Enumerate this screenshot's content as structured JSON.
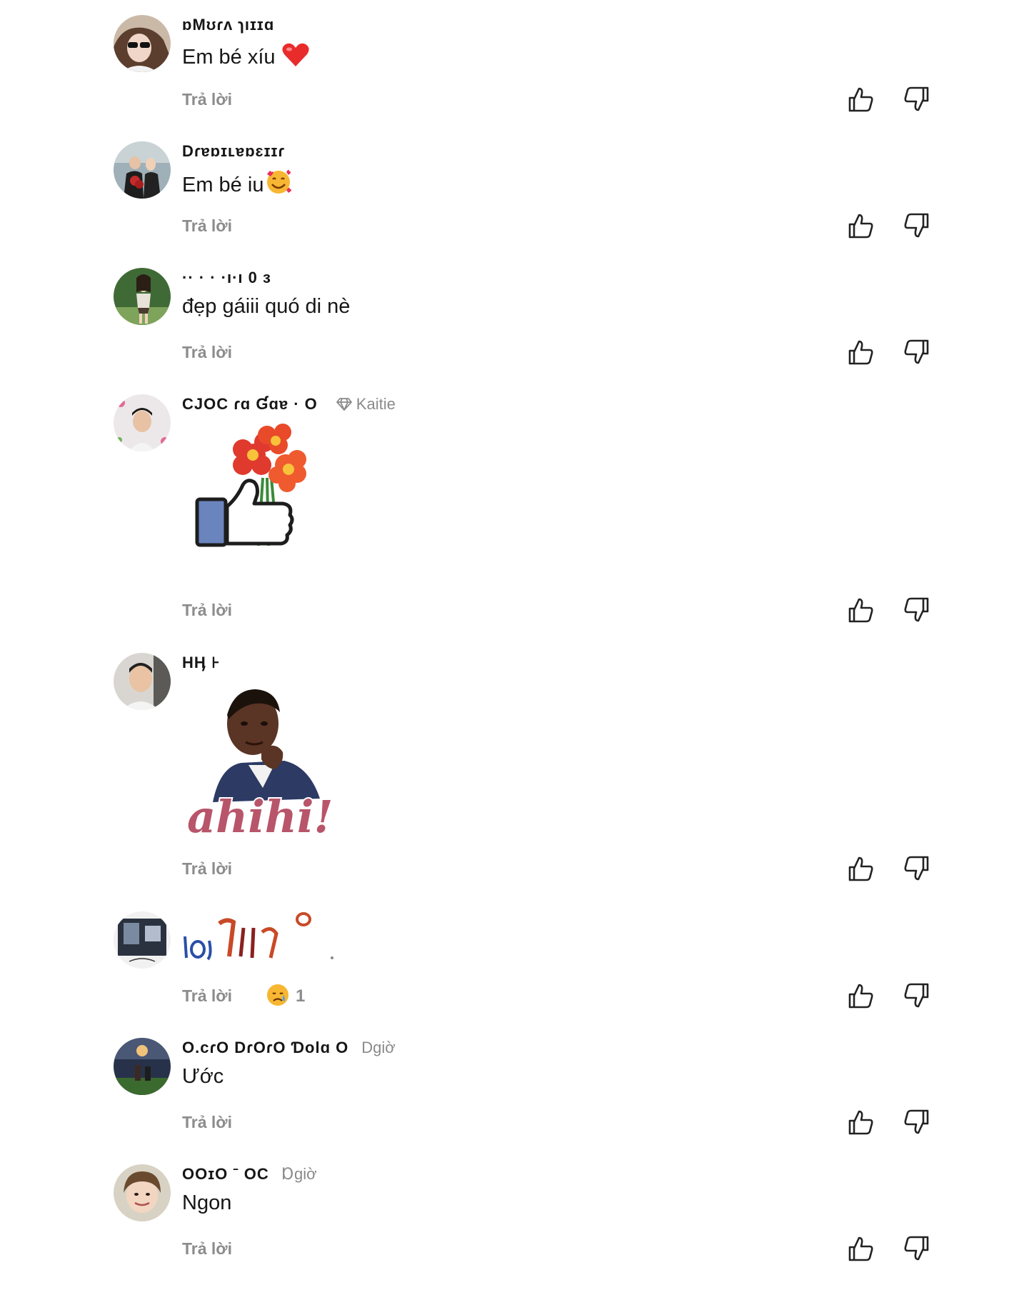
{
  "comments": [
    {
      "username": "ɒMʊɾʌ ɿıɪɪɑ",
      "meta": "",
      "text": "Em bé xíu",
      "emoji": "red-heart",
      "reply_label": "Trả lời"
    },
    {
      "username": "Dɾɐɒɪʟɐɒɛɪɪɾ",
      "meta": "",
      "text": "Em bé iu",
      "emoji": "smiling-face-with-hearts",
      "reply_label": "Trả lời"
    },
    {
      "username": "·· · ·  ·ı·ı  0                  ɜ",
      "meta": "",
      "text": "đẹp gáiii quó di nè",
      "emoji": "",
      "reply_label": "Trả lời"
    },
    {
      "username": "CJOC  ɾɑ Ɠɑɐ   ·  O",
      "meta": "Kaitie",
      "text": "",
      "emoji": "",
      "sticker": "thumb-with-flowers",
      "reply_label": "Trả lời"
    },
    {
      "username": "HӉ  ⊦",
      "meta": "",
      "text": "",
      "emoji": "",
      "sticker": "ahihi",
      "sticker_text": "ahihi!",
      "reply_label": "Trả lời"
    },
    {
      "username": "",
      "meta": "",
      "text": "",
      "emoji": "",
      "sticker": "scribble",
      "reply_label": "Trả lời",
      "reaction_emoji": "sad-relieved-face",
      "reaction_count": "1"
    },
    {
      "username": "O.cɾO DɾOɾO Ɗolɑ O",
      "meta": "Dgiờ",
      "text": "Ước",
      "emoji": "",
      "reply_label": "Trả lời"
    },
    {
      "username": "OOɪO ˉ OC",
      "meta": "Ɒgiờ",
      "text": "Ngon",
      "emoji": "",
      "reply_label": "Trả lời"
    }
  ],
  "colors": {
    "text": "#161616",
    "muted": "#8c8c8c",
    "background": "#ffffff"
  },
  "icons": {
    "like": "thumbs-up-icon",
    "dislike": "thumbs-down-icon",
    "badge": "diamond-icon"
  }
}
